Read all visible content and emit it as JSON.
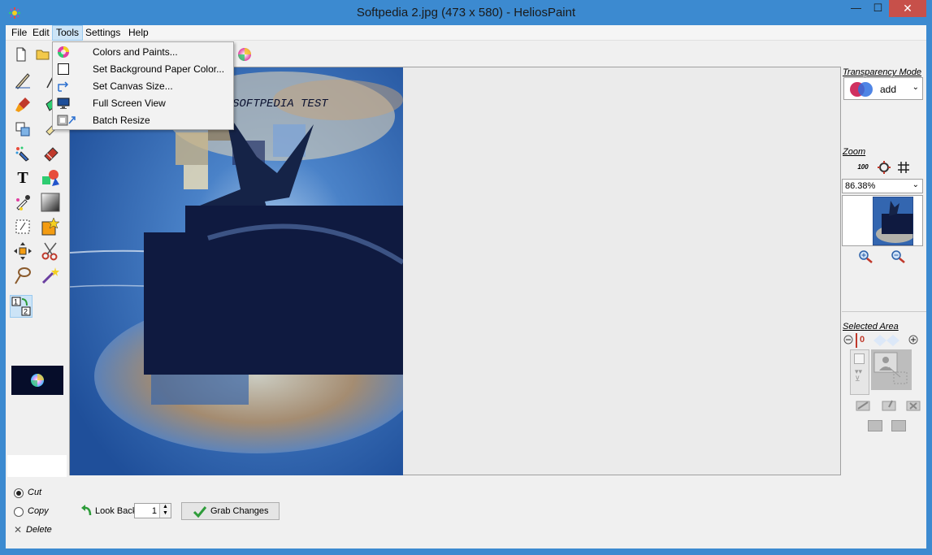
{
  "window": {
    "title": "Softpedia 2.jpg (473 x 580)  - HeliosPaint",
    "minimize": "—",
    "maximize": "☐",
    "close": "✕"
  },
  "menu": {
    "file": "File",
    "edit": "Edit",
    "tools": "Tools",
    "settings": "Settings",
    "help": "Help"
  },
  "tools_menu": [
    {
      "label": "Colors and Paints...",
      "icon": "color-wheel-icon"
    },
    {
      "label": "Set Background Paper Color...",
      "icon": "paper-color-icon"
    },
    {
      "label": "Set Canvas Size...",
      "icon": "canvas-size-icon"
    },
    {
      "label": "Full Screen View",
      "icon": "monitor-icon"
    },
    {
      "label": "Batch Resize",
      "icon": "batch-resize-icon"
    }
  ],
  "canvas": {
    "watermark": "SOFTPEDIA TEST"
  },
  "right_panel": {
    "transparency_label": "Transparency Mode",
    "blend_mode": "add",
    "zoom_label": "Zoom",
    "zoom_100": "100",
    "zoom_value": "86.38%",
    "selected_area_label": "Selected Area",
    "selected_value": "0"
  },
  "bottom": {
    "cut": "Cut",
    "copy": "Copy",
    "delete": "Delete",
    "look_back": "Look Back",
    "look_back_value": "1",
    "grab_changes": "Grab Changes"
  }
}
